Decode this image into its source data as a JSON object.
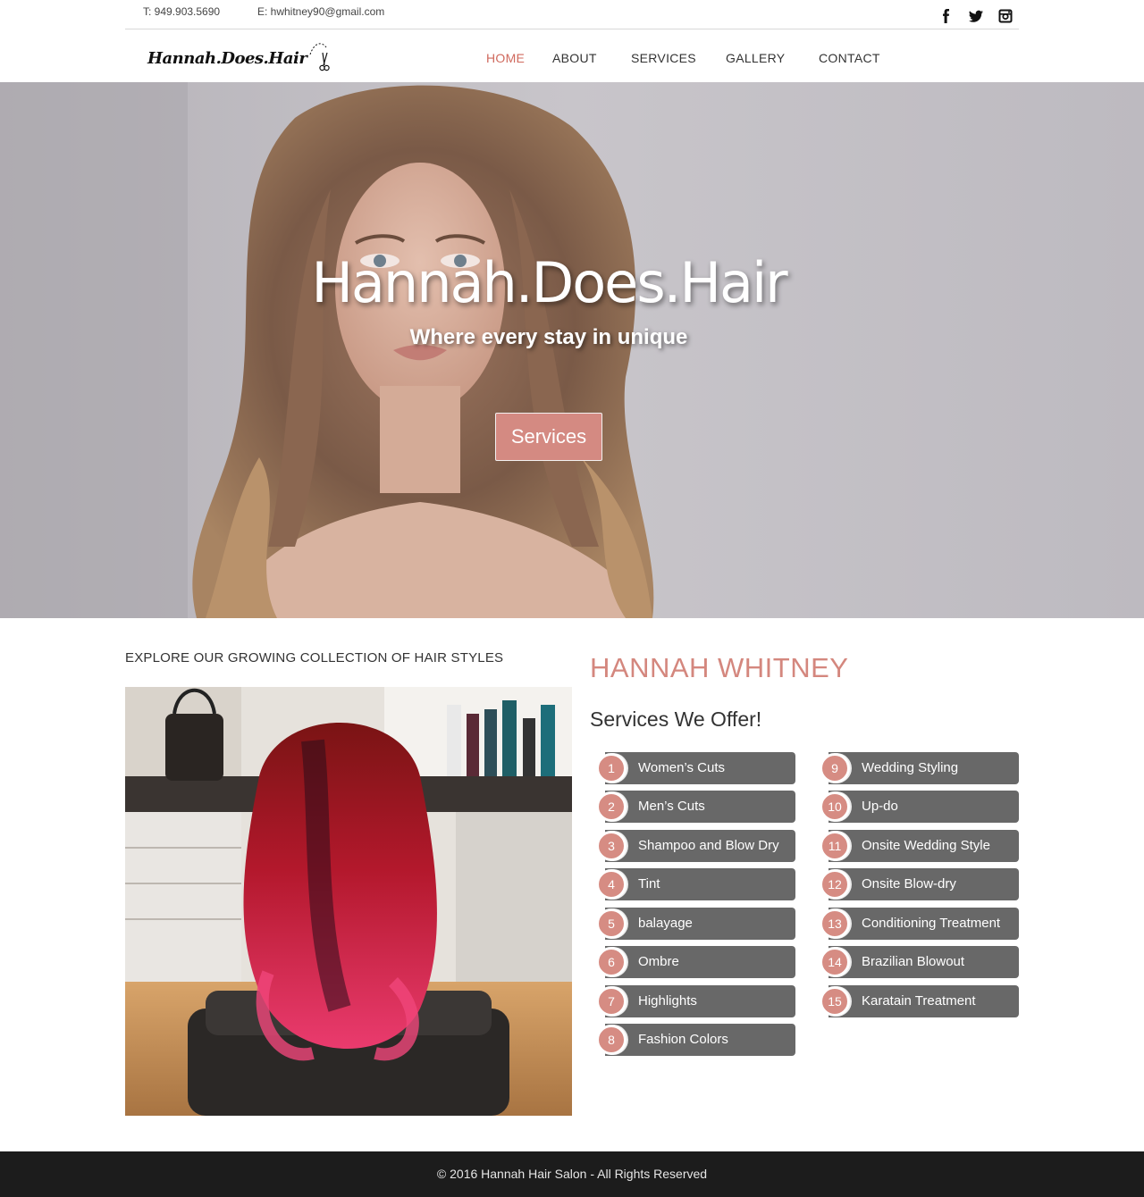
{
  "topbar": {
    "phone": "T: 949.903.5690",
    "email": "E: hwhitney90@gmail.com",
    "social": [
      "facebook-icon",
      "twitter-icon",
      "instagram-icon"
    ]
  },
  "header": {
    "logo_text": "Hannah.Does.Hair",
    "nav": [
      {
        "label": "HOME",
        "active": true
      },
      {
        "label": "ABOUT",
        "active": false
      },
      {
        "label": "SERVICES",
        "active": false
      },
      {
        "label": "GALLERY",
        "active": false
      },
      {
        "label": "CONTACT",
        "active": false
      }
    ]
  },
  "hero": {
    "title": "Hannah.Does.Hair",
    "subtitle": "Where every stay in unique",
    "button": "Services"
  },
  "main": {
    "explore_heading": "EXPLORE OUR GROWING COLLECTION OF HAIR STYLES",
    "owner_name": "HANNAH WHITNEY",
    "services_heading": "Services We Offer!",
    "services_left": [
      {
        "num": "1",
        "label": "Women’s Cuts"
      },
      {
        "num": "2",
        "label": "Men’s Cuts"
      },
      {
        "num": "3",
        "label": "Shampoo and Blow Dry"
      },
      {
        "num": "4",
        "label": "Tint"
      },
      {
        "num": "5",
        "label": "balayage"
      },
      {
        "num": "6",
        "label": "Ombre"
      },
      {
        "num": "7",
        "label": "Highlights"
      },
      {
        "num": "8",
        "label": "Fashion Colors"
      }
    ],
    "services_right": [
      {
        "num": "9",
        "label": "Wedding Styling"
      },
      {
        "num": "10",
        "label": "Up-do"
      },
      {
        "num": "11",
        "label": "Onsite Wedding Style"
      },
      {
        "num": "12",
        "label": "Onsite Blow-dry"
      },
      {
        "num": "13",
        "label": "Conditioning Treatment"
      },
      {
        "num": "14",
        "label": "Brazilian Blowout"
      },
      {
        "num": "15",
        "label": "Karatain Treatment"
      }
    ]
  },
  "footer": {
    "copyright": "© 2016 Hannah Hair Salon - All Rights Reserved"
  },
  "colors": {
    "accent": "#d06a5e",
    "service_badge": "#d68c83",
    "service_bar": "#686868",
    "footer_bg": "#1c1c1c"
  }
}
